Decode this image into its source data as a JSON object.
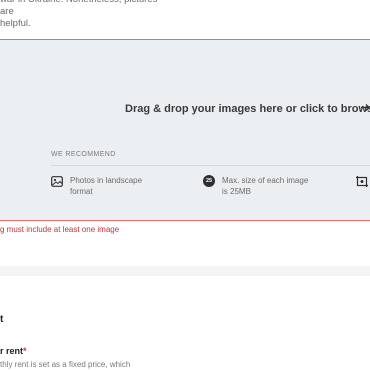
{
  "intro": {
    "line1": "war in Ukraine. Nonetheless, pictures are",
    "line2": "helpful."
  },
  "dropzone": {
    "prompt": "Drag & drop your images here or click to browse",
    "arrow_icon": "arrow-right-icon",
    "border_color": "#e86a6a",
    "background": "#eceff2"
  },
  "recommend": {
    "label": "WE RECOMMEND",
    "items": [
      {
        "icon": "landscape-photo-icon",
        "text": "Photos in landscape format"
      },
      {
        "icon": "size-25-badge-icon",
        "badge": "25",
        "text": "Max. size of each image is 25MB"
      },
      {
        "icon": "image-crop-icon",
        "text": ""
      }
    ]
  },
  "error": {
    "text": "g must include at least one image",
    "color": "#c8323a"
  },
  "section": {
    "heading": "t"
  },
  "rent_field": {
    "label": "r rent",
    "required_mark": "*",
    "help": "thly rent is set as a fixed price, which"
  }
}
